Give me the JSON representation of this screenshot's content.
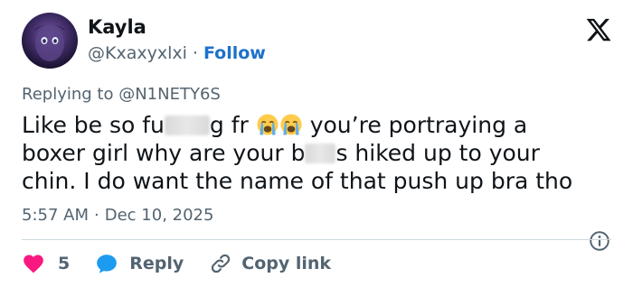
{
  "author": {
    "name": "Kayla",
    "handle": "@Kxaxyxlxi",
    "separator": "·",
    "follow_label": "Follow"
  },
  "replying": {
    "prefix": "Replying to",
    "mention": "@N1NETY6S"
  },
  "tweet": {
    "line1_a": "Like be so fu",
    "line1_b": "g fr",
    "line1_c": "you’re portraying a",
    "line2_a": "boxer girl why are your b",
    "line2_b": "s hiked up to your",
    "line3": "chin. I do want the name of that push up bra tho"
  },
  "meta": {
    "time": "5:57 AM",
    "separator": "·",
    "date": "Dec 10, 2025"
  },
  "actions": {
    "like_count": "5",
    "reply_label": "Reply",
    "copy_label": "Copy link"
  },
  "colors": {
    "like": "#f91880",
    "reply": "#1d9bf0",
    "link": "#1d72c9",
    "muted": "#536471"
  },
  "icons": {
    "logo": "x-logo-icon",
    "emoji": "loudly-crying-face-icon",
    "info": "info-icon",
    "like": "heart-icon",
    "reply": "speech-bubble-icon",
    "copy": "link-icon"
  }
}
